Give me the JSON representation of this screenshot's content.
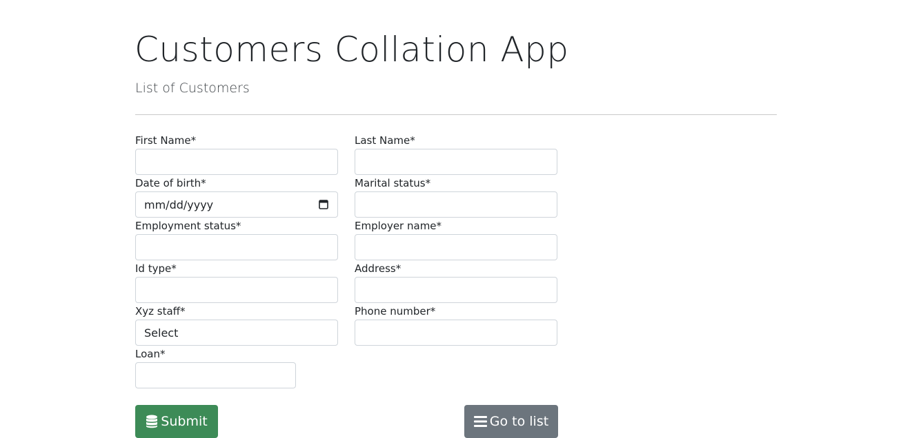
{
  "header": {
    "title": "Customers Collation App",
    "subtitle": "List of Customers"
  },
  "form": {
    "first_name": {
      "label": "First Name*",
      "value": ""
    },
    "last_name": {
      "label": "Last Name*",
      "value": ""
    },
    "date_of_birth": {
      "label": "Date of birth*",
      "placeholder": "mm/dd/yyyy"
    },
    "marital_status": {
      "label": "Marital status*",
      "value": ""
    },
    "employment_status": {
      "label": "Employment status*",
      "value": ""
    },
    "employer_name": {
      "label": "Employer name*",
      "value": ""
    },
    "id_type": {
      "label": "Id type*",
      "value": ""
    },
    "address": {
      "label": "Address*",
      "value": ""
    },
    "xyz_staff": {
      "label": "Xyz staff*",
      "selected": "Select"
    },
    "phone_number": {
      "label": "Phone number*",
      "value": ""
    },
    "loan": {
      "label": "Loan*",
      "value": ""
    }
  },
  "buttons": {
    "submit": {
      "label": "Submit",
      "icon": "database-icon",
      "color": "#3d8b57"
    },
    "go_to_list": {
      "label": "Go to list",
      "icon": "list-icon",
      "color": "#6c757d"
    }
  }
}
